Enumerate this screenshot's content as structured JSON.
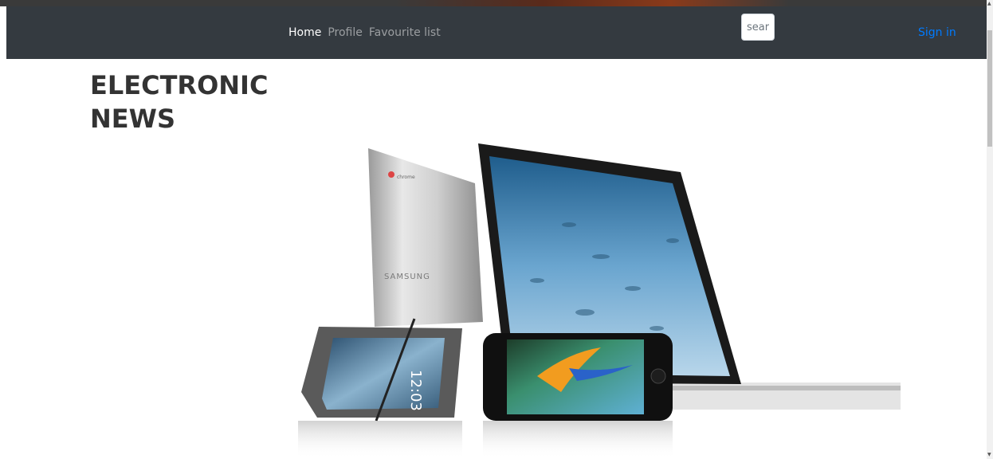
{
  "navbar": {
    "links": [
      {
        "label": "Home",
        "active": true
      },
      {
        "label": "Profile",
        "active": false
      },
      {
        "label": "Favourite list",
        "active": false
      }
    ],
    "search": {
      "placeholder": "search"
    },
    "signin_label": "Sign in"
  },
  "main": {
    "title": "ELECTRONIC NEWS",
    "hero_image": {
      "tablet_brand": "SAMSUNG",
      "tablet_logo_text": "chrome",
      "phone_time": "12:03"
    }
  },
  "colors": {
    "navbar_bg": "#343a40",
    "active_link": "#ffffff",
    "inactive_link": "rgba(255,255,255,0.5)",
    "signin": "#007bff",
    "title": "#333333"
  },
  "icons": [
    "scroll-up-arrow-icon",
    "scroll-down-arrow-icon"
  ]
}
